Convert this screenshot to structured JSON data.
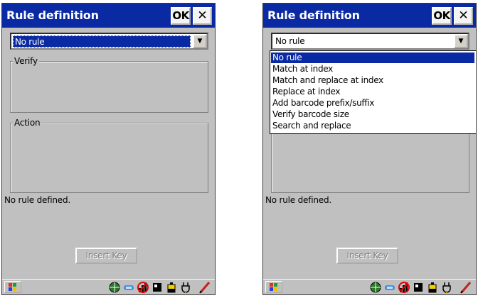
{
  "screens": [
    {
      "title": "Rule definition",
      "ok_label": "OK",
      "close_label": "✕",
      "rule_select": {
        "value": "No rule"
      },
      "verify_label": "Verify",
      "action_label": "Action",
      "status": "No rule defined.",
      "insert_key_label": "Insert Key",
      "dropdown_open": false
    },
    {
      "title": "Rule definition",
      "ok_label": "OK",
      "close_label": "✕",
      "rule_select": {
        "value": "No rule"
      },
      "status": "No rule defined.",
      "insert_key_label": "Insert Key",
      "dropdown_open": true,
      "dropdown_options": [
        "No rule",
        "Match at index",
        "Match and replace at index",
        "Replace at index",
        "Add barcode prefix/suffix",
        "Verify barcode size",
        "Search and replace"
      ],
      "selected_option": "No rule"
    }
  ],
  "taskbar_icons": [
    "windows-start-icon",
    "globe-icon",
    "connection-icon",
    "no-signal-icon",
    "card-icon",
    "battery-icon",
    "power-icon",
    "pen-icon"
  ],
  "colors": {
    "titlebar": "#0a2aa4",
    "selection": "#0a2aa4",
    "background": "#c0c0c0"
  }
}
